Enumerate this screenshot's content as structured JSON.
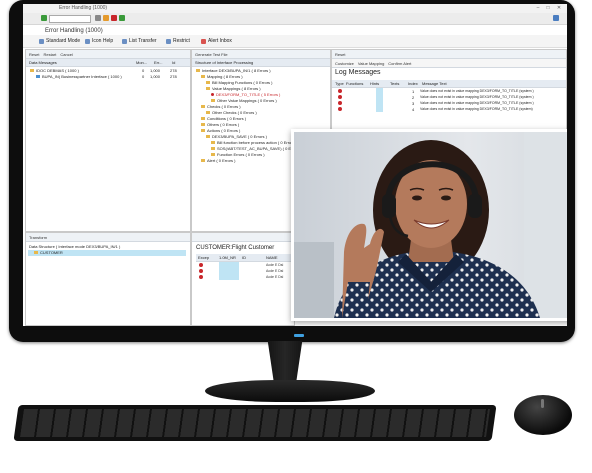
{
  "window": {
    "title": "Error Handling (1000)",
    "app_title": "Error Handling (1000)",
    "controls": {
      "minimize": "–",
      "maximize": "□",
      "close": "✕"
    }
  },
  "toolbar": {
    "buttons": [
      "Standard Mode",
      "Icon Help",
      "List Transfer",
      "Restrict",
      "Alert Inbox"
    ]
  },
  "left_pane": {
    "toolbar": [
      "Reset",
      "Restart",
      "Cancel"
    ],
    "header": "Data Messages",
    "cols": [
      "Mon...",
      "Err...",
      "Id"
    ],
    "tree": [
      {
        "label": "IDOC DEBMAS ( 1000 )",
        "v1": "",
        "v2": "",
        "v3": "0",
        "v4": "1,000",
        "v5": "278"
      },
      {
        "label": "BUPA_IN( Businesspartner Interface ( 1000 )",
        "v1": "",
        "v2": "",
        "v3": "0",
        "v4": "1,000",
        "v5": "278"
      }
    ]
  },
  "mid_pane": {
    "toolbar": [
      "Generate Test File"
    ],
    "header": "Structure of Interface Processing",
    "tree": [
      {
        "label": "Interface DEX3/BUPA_IN/1 ( 8 Errors )",
        "level": 0,
        "err": false
      },
      {
        "label": "Mapping ( 8 Errors )",
        "level": 1,
        "err": false
      },
      {
        "label": "Bill Mapping Functions ( 0 Errors )",
        "level": 2,
        "err": false
      },
      {
        "label": "Value Mappings ( 8 Errors )",
        "level": 2,
        "err": false
      },
      {
        "label": "DEX3/FORM_TO_TITLE ( 5 Errors )",
        "level": 3,
        "err": true
      },
      {
        "label": "Other Value Mappings ( 0 Errors )",
        "level": 3,
        "err": false
      },
      {
        "label": "Checks ( 0 Errors )",
        "level": 1,
        "err": false
      },
      {
        "label": "Other Checks ( 0 Errors )",
        "level": 2,
        "err": false
      },
      {
        "label": "Conditions ( 0 Errors )",
        "level": 1,
        "err": false
      },
      {
        "label": "Others ( 0 Errors )",
        "level": 1,
        "err": false
      },
      {
        "label": "Actions ( 0 Errors )",
        "level": 1,
        "err": false
      },
      {
        "label": "DEX3/BUPA_SAVE ( 0 Errors )",
        "level": 2,
        "err": false
      },
      {
        "label": "Bill function before process action ( 0 Errors )",
        "level": 3,
        "err": false
      },
      {
        "label": "SOS(/ABT/TEST_AC_BUPA_SAVE) ( 0 Errors )",
        "level": 3,
        "err": false
      },
      {
        "label": "Function Errors ( 0 Errors )",
        "level": 3,
        "err": false
      },
      {
        "label": "Alert ( 0 Errors )",
        "level": 1,
        "err": false
      }
    ]
  },
  "right_pane": {
    "toolbar": [
      "Reset"
    ],
    "toolbar2": [
      "Customize",
      "Value Mapping",
      "Confirm Alert"
    ],
    "title": "Log Messages",
    "cols": [
      "Type",
      "Functions",
      "Hints",
      "Texts",
      "Index",
      "Message Text"
    ],
    "rows": [
      {
        "idx": "1",
        "text": "Value does not exist in value mapping DEX3/FORM_TO_TITLE (system )"
      },
      {
        "idx": "2",
        "text": "Value does not exist in value mapping DEX3/FORM_TO_TITLE (system )"
      },
      {
        "idx": "3",
        "text": "Value does not exist in value mapping DEX3/FORM_TO_TITLE (system )"
      },
      {
        "idx": "4",
        "text": "Value does not exist in value mapping DEX3/FORM_TO_TITLE (system)"
      }
    ]
  },
  "bottom_left": {
    "toolbar": [
      "Transform"
    ],
    "header": "Data Structure ( Interface mode DEX3/BUPA_IN/1 )",
    "tree": [
      "CUSTOMER"
    ]
  },
  "bottom_mid": {
    "title": "CUSTOMER:Flight Customer",
    "cols": [
      "Excep",
      "1.0M_NR",
      "ID",
      "NAME"
    ],
    "rows": [
      {
        "name": "Acde E Dsl"
      },
      {
        "name": "Acde E Dsl"
      },
      {
        "name": "Acde E Dsl"
      }
    ]
  },
  "video": {
    "description_icon": "video-call-person-icon",
    "colors": {
      "wall": "#d9dde2",
      "shirt": "#1d2f4f",
      "skin": "#b47a5c",
      "hair": "#2a1a14",
      "headset": "#1a1a1a"
    }
  },
  "colors": {
    "bezel": "#0d0d0d",
    "error_red": "#c8262b",
    "selection_blue": "#bfe4f4",
    "power_led": "#3fa0e0"
  }
}
